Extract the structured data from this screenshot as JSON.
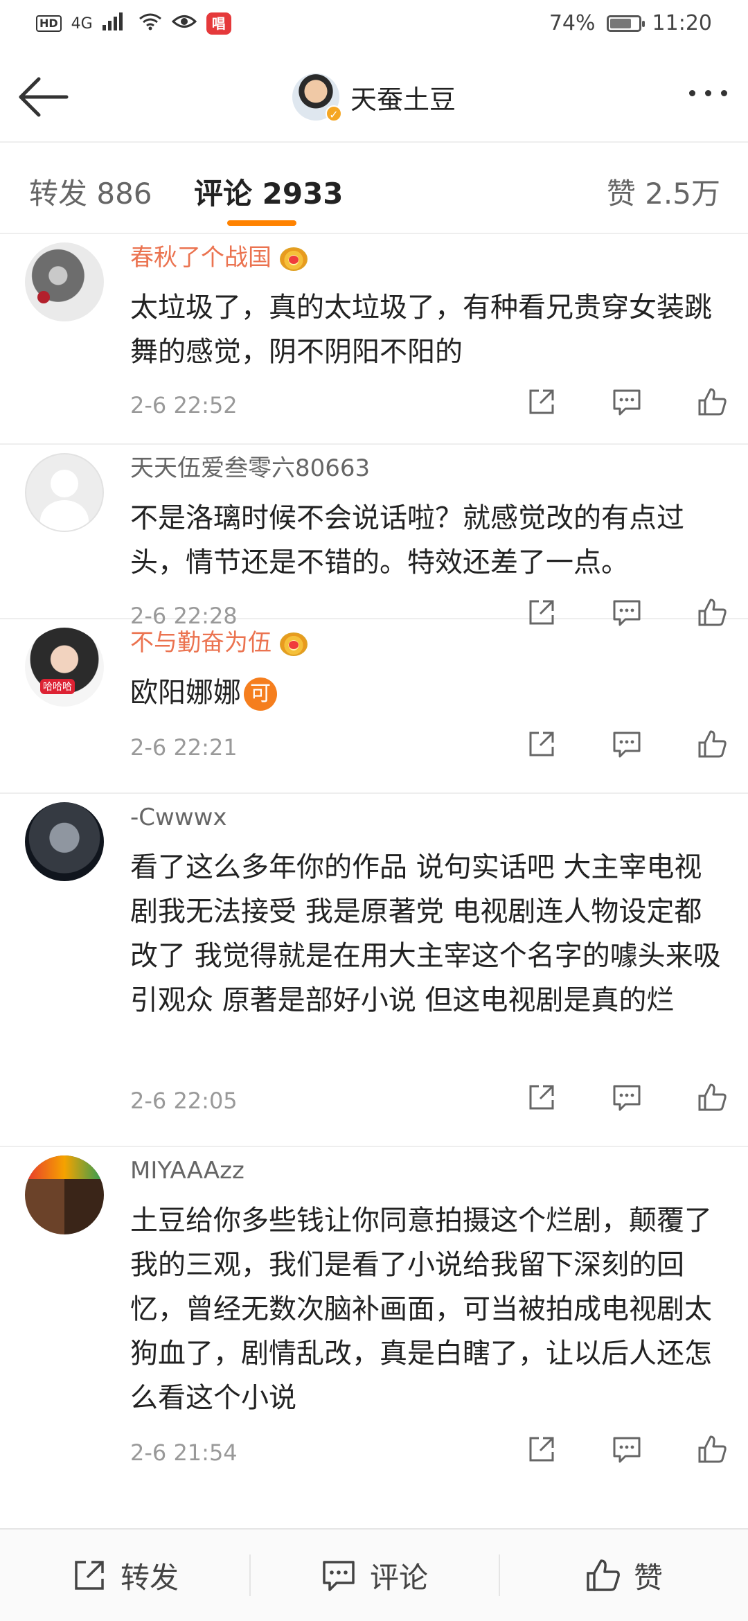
{
  "status_bar": {
    "network": "4G",
    "battery": "74%",
    "battery_level": 0.74,
    "time": "11:20",
    "app_badge_text": "唱"
  },
  "header": {
    "title": "天蚕土豆"
  },
  "tabs": {
    "repost": "转发 886",
    "comments": "评论 2933",
    "likes": "赞 2.5万"
  },
  "comments": [
    {
      "name": "春秋了个战国",
      "vip": true,
      "text": "太垃圾了，真的太垃圾了，有种看兄贵穿女装跳舞的感觉，阴不阴阳不阳的",
      "time": "2-6 22:52"
    },
    {
      "name": "天天伍爱叁零六80663",
      "vip": false,
      "text": "不是洛璃时候不会说话啦？就感觉改的有点过头，情节还是不错的。特效还差了一点。",
      "time": "2-6 22:28"
    },
    {
      "name": "不与勤奋为伍",
      "vip": true,
      "text": "欧阳娜娜",
      "emoji": "可",
      "time": "2-6 22:21"
    },
    {
      "name": "-Cwwwx",
      "vip": false,
      "text": "看了这么多年你的作品 说句实话吧 大主宰电视剧我无法接受 我是原著党 电视剧连人物设定都改了 我觉得就是在用大主宰这个名字的噱头来吸引观众 原著是部好小说 但这电视剧是真的烂",
      "time": "2-6 22:05"
    },
    {
      "name": "MIYAAAzz",
      "vip": false,
      "text": "土豆给你多些钱让你同意拍摄这个烂剧，颠覆了我的三观，我们是看了小说给我留下深刻的回忆，曾经无数次脑补画面，可当被拍成电视剧太狗血了，剧情乱改，真是白瞎了，让以后人还怎么看这个小说",
      "time": "2-6 21:54"
    }
  ],
  "bottom_bar": {
    "repost": "转发",
    "comment": "评论",
    "like": "赞"
  },
  "colors": {
    "accent": "#ff8200",
    "vip_name": "#eb7350"
  },
  "icons": [
    "back-arrow-icon",
    "more-icon",
    "share-icon",
    "comment-icon",
    "like-icon",
    "vip-crown-icon",
    "verified-icon"
  ]
}
